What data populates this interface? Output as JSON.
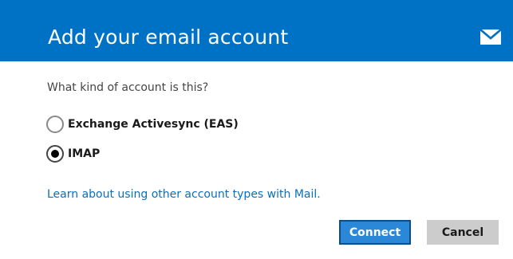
{
  "header": {
    "title": "Add your email account",
    "icon": "mail-envelope-icon",
    "background_color": "#0072c6"
  },
  "question": "What kind of account is this?",
  "account_types": [
    {
      "label": "Exchange Activesync (EAS)",
      "selected": false
    },
    {
      "label": "IMAP",
      "selected": true
    }
  ],
  "learn_more_link": "Learn about using other account types with Mail.",
  "buttons": {
    "connect_label": "Connect",
    "cancel_label": "Cancel"
  },
  "colors": {
    "accent": "#0072c6",
    "link": "#0a6fbe",
    "primary_button": "#2b88d8",
    "secondary_button": "#cccccc"
  }
}
